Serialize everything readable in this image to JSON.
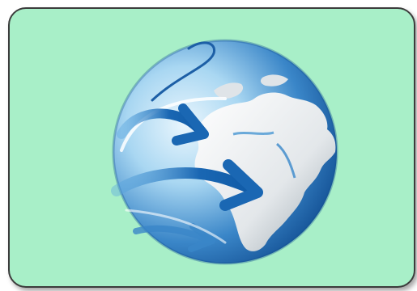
{
  "icon": {
    "name": "globe-with-arrows-icon",
    "colors": {
      "tile_background": "#a8efc8",
      "tile_border": "#3c3c3c",
      "ocean_dark": "#1b5fa8",
      "ocean_light": "#bfe4f7",
      "land": "#eef1f3",
      "arrow": "#1a67b3"
    }
  }
}
